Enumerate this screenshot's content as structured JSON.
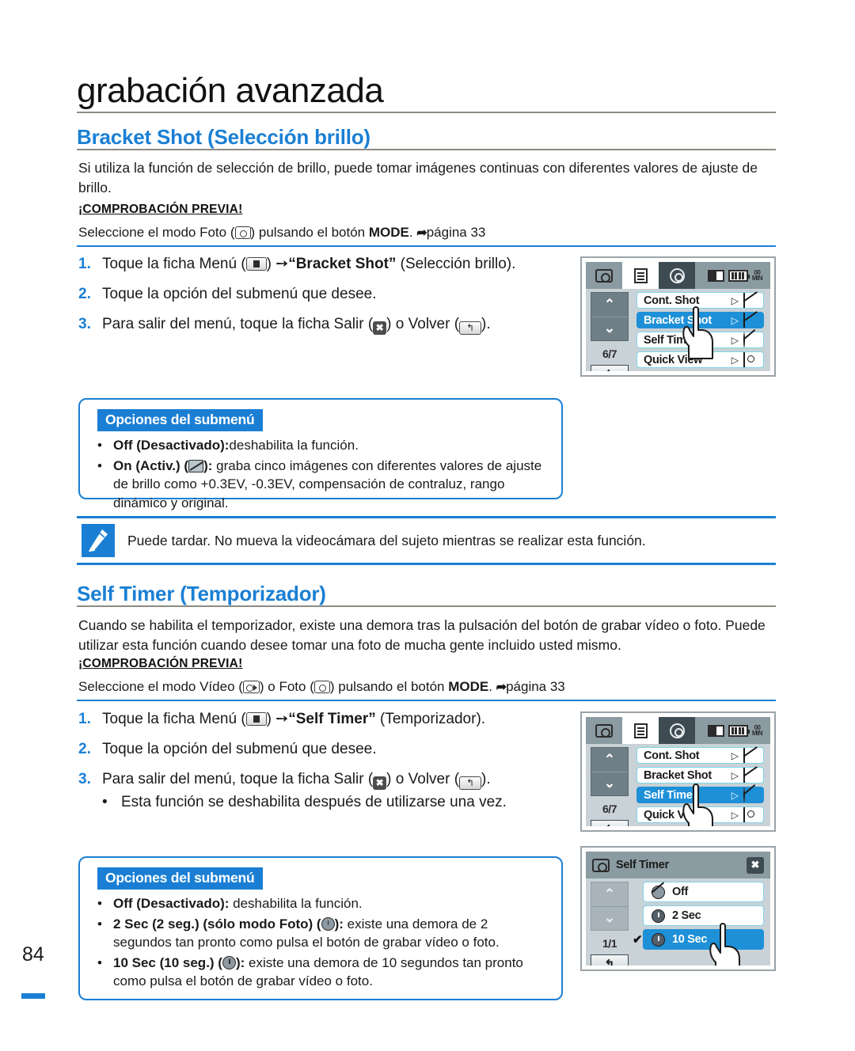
{
  "page": {
    "chapter_title": "grabación avanzada",
    "page_number": "84"
  },
  "section1": {
    "heading": "Bracket Shot (Selección brillo)",
    "intro": "Si utiliza la función de selección de brillo, puede tomar imágenes continuas con diferentes valores de ajuste de brillo.",
    "precheck_label": "¡COMPROBACIÓN PREVIA!",
    "precheck_pre": "Seleccione el modo Foto (",
    "precheck_mid": ") pulsando el botón ",
    "precheck_bold": "MODE",
    "precheck_post": ". ",
    "precheck_page": "página 33",
    "steps": [
      {
        "num": "1.",
        "pre": "Toque la ficha Menú (",
        "mid": ") ",
        "arrow": "➙",
        "quoted": "“Bracket Shot”",
        "post": " (Selección brillo)."
      },
      {
        "num": "2.",
        "text": "Toque la opción del submenú que desee."
      },
      {
        "num": "3.",
        "pre": "Para salir del menú, toque la ficha Salir (",
        "mid": ") o Volver (",
        "post": ")."
      }
    ],
    "options": {
      "title": "Opciones del submenú",
      "items": [
        {
          "bold": "Off (Desactivado):",
          "text": "deshabilita la función."
        },
        {
          "bold": "On (Activ.) (",
          "bold2": "):",
          "text": " graba cinco imágenes con diferentes valores de ajuste de brillo como +0.3EV, -0.3EV, compensación de contraluz, rango dinámico y original."
        }
      ]
    },
    "note": "Puede tardar. No mueva la videocámara del sujeto mientras se realizar esta función."
  },
  "section2": {
    "heading": "Self Timer (Temporizador)",
    "intro": "Cuando se habilita el temporizador, existe una demora tras la pulsación del botón de grabar vídeo o foto. Puede utilizar esta función cuando desee tomar una foto de mucha gente incluido usted mismo.",
    "precheck_label": "¡COMPROBACIÓN PREVIA!",
    "precheck_pre": "Seleccione el modo Vídeo (",
    "precheck_mid": ") o Foto (",
    "precheck_mid2": ") pulsando el botón ",
    "precheck_bold": "MODE",
    "precheck_post": ". ",
    "precheck_page": "página 33",
    "steps": [
      {
        "num": "1.",
        "pre": "Toque la ficha Menú (",
        "mid": ") ",
        "arrow": "➙",
        "quoted": "“Self Timer”",
        "post": " (Temporizador)."
      },
      {
        "num": "2.",
        "text": "Toque la opción del submenú que desee."
      },
      {
        "num": "3.",
        "pre": "Para salir del menú, toque la ficha Salir (",
        "mid": ") o Volver (",
        "post": ")."
      }
    ],
    "sub_bullet": "Esta función se deshabilita después de utilizarse una vez.",
    "options": {
      "title": "Opciones del submenú",
      "items": [
        {
          "bold": "Off (Desactivado):",
          "text": " deshabilita la función."
        },
        {
          "bold": "2 Sec (2 seg.) (sólo modo Foto) (",
          "bold2": "):",
          "text": " existe una demora de 2 segundos tan pronto como pulsa el botón de grabar vídeo o foto."
        },
        {
          "bold": "10 Sec (10 seg.) (",
          "bold2": "):",
          "text": " existe una demora de 10 segundos tan pronto como pulsa el botón de grabar vídeo o foto."
        }
      ]
    }
  },
  "lcd1": {
    "tabs": [
      "camera-tab",
      "menu-tab",
      "settings-tab"
    ],
    "pager": "6/7",
    "back": "↰",
    "rows": [
      {
        "label": "Cont. Shot",
        "tri": "▷",
        "selected": false
      },
      {
        "label": "Bracket Shot",
        "tri": "▷",
        "selected": true
      },
      {
        "label": "Self Timer",
        "tri": "▷",
        "selected": false
      },
      {
        "label": "Quick View",
        "tri": "▷",
        "selected": false
      }
    ],
    "status": {
      "minutes": "00",
      "min_label": "MIN"
    }
  },
  "lcd2": {
    "pager": "6/7",
    "back": "↰",
    "rows": [
      {
        "label": "Cont. Shot",
        "tri": "▷",
        "selected": false
      },
      {
        "label": "Bracket Shot",
        "tri": "▷",
        "selected": false
      },
      {
        "label": "Self Timer",
        "tri": "▷",
        "selected": true
      },
      {
        "label": "Quick View",
        "tri": "▷",
        "selected": false
      }
    ],
    "status": {
      "minutes": "00",
      "min_label": "MIN"
    }
  },
  "lcd3": {
    "title": "Self Timer",
    "close": "✖",
    "pager": "1/1",
    "back": "↰",
    "rows": [
      {
        "label": "Off",
        "selected": false,
        "checked": false
      },
      {
        "label": "2 Sec",
        "selected": false,
        "checked": false
      },
      {
        "label": "10 Sec",
        "selected": true,
        "checked": true
      }
    ]
  },
  "colors": {
    "accent_blue": "#1a7fd4",
    "lcd_select": "#1e90d8",
    "rule_gray": "#8d8b82"
  }
}
